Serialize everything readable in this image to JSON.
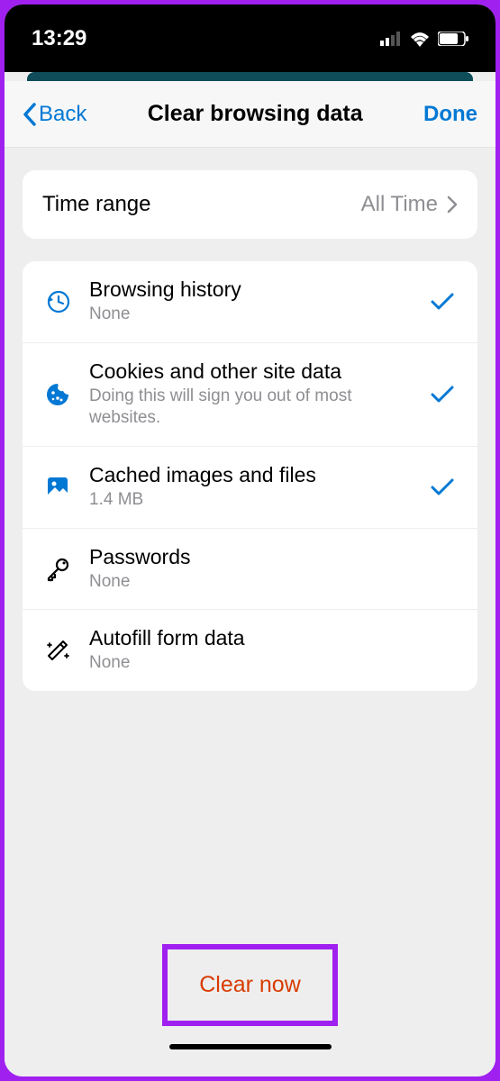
{
  "statusBar": {
    "time": "13:29"
  },
  "nav": {
    "back": "Back",
    "title": "Clear browsing data",
    "done": "Done"
  },
  "timeRange": {
    "label": "Time range",
    "value": "All Time"
  },
  "options": [
    {
      "title": "Browsing history",
      "subtitle": "None",
      "checked": true,
      "iconColor": "#0078d4"
    },
    {
      "title": "Cookies and other site data",
      "subtitle": "Doing this will sign you out of most websites.",
      "checked": true,
      "iconColor": "#0078d4"
    },
    {
      "title": "Cached images and files",
      "subtitle": "1.4 MB",
      "checked": true,
      "iconColor": "#0078d4"
    },
    {
      "title": "Passwords",
      "subtitle": "None",
      "checked": false,
      "iconColor": "#000"
    },
    {
      "title": "Autofill form data",
      "subtitle": "None",
      "checked": false,
      "iconColor": "#000"
    }
  ],
  "clearButton": "Clear now"
}
